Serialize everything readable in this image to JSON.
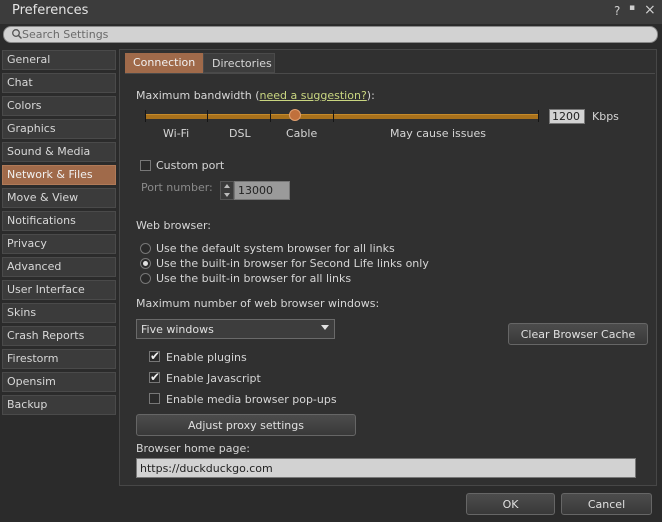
{
  "window": {
    "title": "Preferences",
    "help_label": "?",
    "minimize_label": "▪",
    "close_label": "×"
  },
  "search": {
    "placeholder": "Search Settings"
  },
  "sidebar": {
    "items": [
      {
        "label": "General"
      },
      {
        "label": "Chat"
      },
      {
        "label": "Colors"
      },
      {
        "label": "Graphics"
      },
      {
        "label": "Sound & Media"
      },
      {
        "label": "Network & Files"
      },
      {
        "label": "Move & View"
      },
      {
        "label": "Notifications"
      },
      {
        "label": "Privacy"
      },
      {
        "label": "Advanced"
      },
      {
        "label": "User Interface"
      },
      {
        "label": "Skins"
      },
      {
        "label": "Crash Reports"
      },
      {
        "label": "Firestorm"
      },
      {
        "label": "Opensim"
      },
      {
        "label": "Backup"
      }
    ],
    "active": "Network & Files"
  },
  "tabs": [
    {
      "label": "Connection",
      "active": true
    },
    {
      "label": "Directories",
      "active": false
    }
  ],
  "bandwidth": {
    "label_prefix": "Maximum bandwidth (",
    "link": "need a suggestion?",
    "label_suffix": "):",
    "ticks": [
      "Wi-Fi",
      "DSL",
      "Cable",
      "May cause issues"
    ],
    "value": "1200",
    "unit": "Kbps",
    "slider_fraction": 0.39
  },
  "port": {
    "checkbox_label": "Custom port",
    "checked": false,
    "field_label": "Port number:",
    "value": "13000"
  },
  "web_browser": {
    "heading": "Web browser:",
    "options": [
      {
        "label": "Use the default system browser for all links",
        "selected": false
      },
      {
        "label": "Use the built-in browser for Second Life links only",
        "selected": true
      },
      {
        "label": "Use the built-in browser for all links",
        "selected": false
      }
    ]
  },
  "windows": {
    "heading": "Maximum number of web browser windows:",
    "selected": "Five windows",
    "clear_cache_label": "Clear Browser Cache"
  },
  "options": [
    {
      "label": "Enable plugins",
      "checked": true
    },
    {
      "label": "Enable Javascript",
      "checked": true
    },
    {
      "label": "Enable media browser pop-ups",
      "checked": false
    }
  ],
  "proxy_button": "Adjust proxy settings",
  "home_page": {
    "label": "Browser home page:",
    "value": "https://duckduckgo.com"
  },
  "footer": {
    "ok_label": "OK",
    "cancel_label": "Cancel"
  },
  "colors": {
    "accent": "#a06a4a",
    "link": "#c9d680",
    "slider": "#a8711c"
  }
}
